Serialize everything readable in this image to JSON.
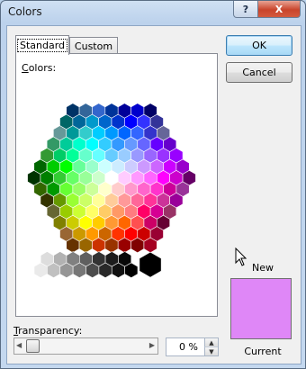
{
  "window": {
    "title": "Colors"
  },
  "titlebar": {
    "help_glyph": "?",
    "close_glyph": "X"
  },
  "tabs": [
    {
      "label": "Standard",
      "selected": true
    },
    {
      "label": "Custom",
      "selected": false
    }
  ],
  "standard": {
    "colors_label_hotkey": "C",
    "colors_label_rest": "olors:"
  },
  "buttons": {
    "ok": "OK",
    "cancel": "Cancel"
  },
  "preview": {
    "new_label": "New",
    "current_label": "Current",
    "current_color": "#df87f7"
  },
  "transparency": {
    "label_hotkey": "T",
    "label_rest": "ransparency:",
    "value_text": "0 %",
    "value": 0
  },
  "palette": {
    "rows": [
      [
        "#003366",
        "#336699",
        "#3366cc",
        "#003399",
        "#000099",
        "#0000cc",
        "#000066"
      ],
      [
        "#006666",
        "#006699",
        "#0099cc",
        "#0066cc",
        "#0033cc",
        "#0000ff",
        "#3333ff",
        "#333399"
      ],
      [
        "#669999",
        "#009999",
        "#33cccc",
        "#00ccff",
        "#0099ff",
        "#0066ff",
        "#3366ff",
        "#3333cc",
        "#666699"
      ],
      [
        "#339966",
        "#00cc99",
        "#00ffcc",
        "#00ffff",
        "#33ccff",
        "#3399ff",
        "#6699ff",
        "#6666ff",
        "#6600ff",
        "#6600cc"
      ],
      [
        "#339933",
        "#00cc66",
        "#00ff99",
        "#66ffcc",
        "#66ffff",
        "#66ccff",
        "#99ccff",
        "#9999ff",
        "#9966ff",
        "#9933ff",
        "#9900ff"
      ],
      [
        "#006600",
        "#00cc00",
        "#00ff00",
        "#66ff99",
        "#99ffcc",
        "#ccffff",
        "#ccecff",
        "#ccccff",
        "#cc99ff",
        "#cc66ff",
        "#cc00ff",
        "#9900cc"
      ],
      [
        "#003300",
        "#008000",
        "#33cc33",
        "#66ff66",
        "#99ff99",
        "#ccffcc",
        "#ffffff",
        "#ffccff",
        "#ff99ff",
        "#ff66ff",
        "#ff00ff",
        "#cc00cc",
        "#660066"
      ],
      [
        "#336600",
        "#009900",
        "#66ff33",
        "#99ff66",
        "#ccff99",
        "#ffffcc",
        "#ffcccc",
        "#ff99cc",
        "#ff66cc",
        "#ff33cc",
        "#cc0099",
        "#993399"
      ],
      [
        "#333300",
        "#669900",
        "#99ff33",
        "#ccff66",
        "#ffff99",
        "#ffcc99",
        "#ff9999",
        "#ff6699",
        "#ff3399",
        "#cc3399",
        "#990099"
      ],
      [
        "#666633",
        "#99cc00",
        "#ccff33",
        "#ffff66",
        "#ffcc66",
        "#ff9966",
        "#ff7c80",
        "#ff0066",
        "#d60093",
        "#993366"
      ],
      [
        "#808000",
        "#cccc00",
        "#ffff00",
        "#ffcc00",
        "#ff9933",
        "#ff6600",
        "#ff5050",
        "#cc0066",
        "#660033"
      ],
      [
        "#996633",
        "#cc9900",
        "#ff9900",
        "#cc6600",
        "#ff3300",
        "#ff0000",
        "#cc0000",
        "#990033"
      ],
      [
        "#663300",
        "#996600",
        "#cc3300",
        "#993300",
        "#990000",
        "#800000",
        "#a50021"
      ]
    ],
    "grays": [
      [
        "#ffffff",
        "#dddddd",
        "#b2b2b2",
        "#808080",
        "#5f5f5f",
        "#333333",
        "#1c1c1c",
        "#080808"
      ],
      [
        "#eaeaea",
        "#c0c0c0",
        "#969696",
        "#777777",
        "#4d4d4d",
        "#292929",
        "#111111",
        "#000000"
      ]
    ],
    "black": "#000000"
  }
}
